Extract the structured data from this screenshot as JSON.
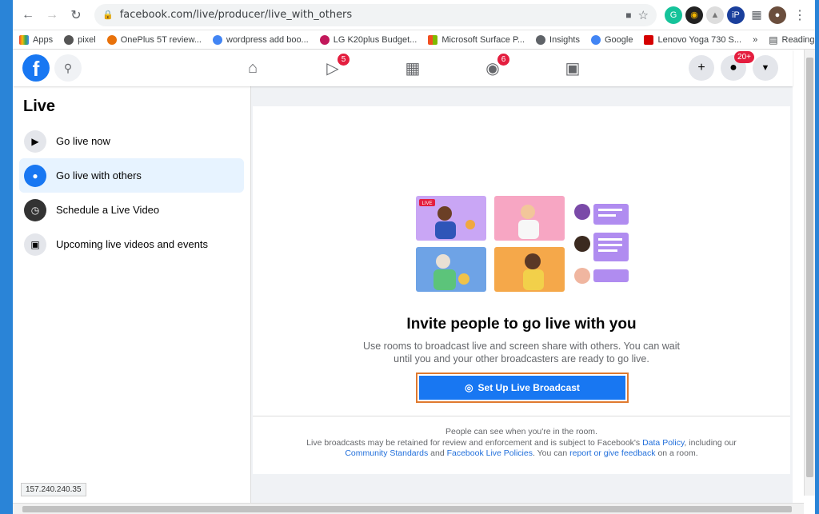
{
  "browser": {
    "url": "facebook.com/live/producer/live_with_others",
    "status_url": "157.240.240.35",
    "bookmarks": [
      "Apps",
      "pixel",
      "OnePlus 5T review...",
      "wordpress add boo...",
      "LG K20plus Budget...",
      "Microsoft Surface P...",
      "Insights",
      "Google",
      "Lenovo Yoga 730 S..."
    ],
    "more_bookmarks": "»",
    "reading_list": "Reading list",
    "bookmark_colors": [
      "#4285f4",
      "#555555",
      "#e8710a",
      "#4285f4",
      "#c2185b",
      "#f25022",
      "#5f6368",
      "#4285f4",
      "#d50000"
    ]
  },
  "fb": {
    "logo_letter": "f",
    "nav_badges": {
      "watch": "5",
      "groups": "6"
    },
    "notif_badge": "20+"
  },
  "sidebar": {
    "title": "Live",
    "items": [
      {
        "label": "Go live now",
        "icon": "camera-icon"
      },
      {
        "label": "Go live with others",
        "icon": "people-icon"
      },
      {
        "label": "Schedule a Live Video",
        "icon": "clock-icon"
      },
      {
        "label": "Upcoming live videos and events",
        "icon": "calendar-icon"
      }
    ]
  },
  "main": {
    "live_badge": "LIVE",
    "title": "Invite people to go live with you",
    "description": "Use rooms to broadcast live and screen share with others. You can wait until you and your other broadcasters are ready to go live.",
    "setup_button": "Set Up Live Broadcast",
    "footer": {
      "line1": "People can see when you're in the room.",
      "line2_a": "Live broadcasts may be retained for review and enforcement and is subject to Facebook's ",
      "data_policy": "Data Policy",
      "line2_b": ", including our ",
      "community_standards": "Community Standards",
      "and": " and ",
      "live_policies": "Facebook Live Policies",
      "line3_a": ". You can ",
      "report": "report or give feedback",
      "line3_b": " on a room."
    }
  },
  "colors": {
    "accent": "#1877f2",
    "highlight_border": "#e07a2f",
    "badge": "#e41e3f"
  }
}
